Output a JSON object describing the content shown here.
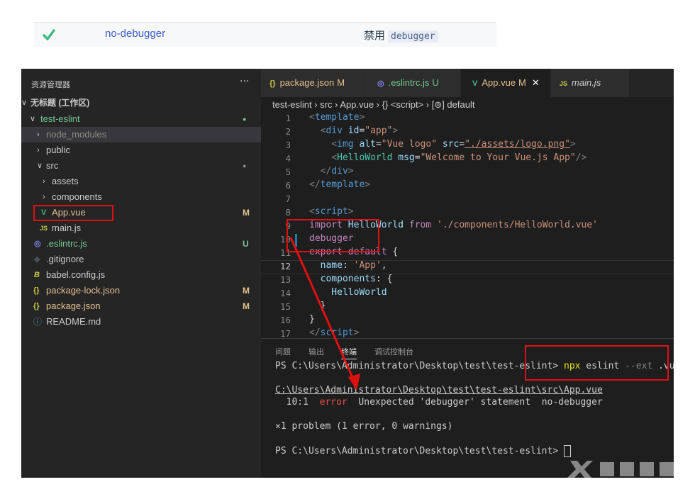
{
  "rule_row": {
    "rule_name": "no-debugger",
    "description_text": "禁用",
    "description_code": "debugger"
  },
  "explorer": {
    "title": "资源管理器",
    "more": "···",
    "workspace": "无标题 (工作区)",
    "items": [
      {
        "label": "test-eslint",
        "status": "●",
        "chev": "∨"
      },
      {
        "label": "node_modules",
        "chev": "›"
      },
      {
        "label": "public",
        "chev": "›"
      },
      {
        "label": "src",
        "status": "●",
        "chev": "∨"
      },
      {
        "label": "assets",
        "chev": "›"
      },
      {
        "label": "components",
        "chev": "›"
      },
      {
        "label": "App.vue",
        "status": "M",
        "icon": "V"
      },
      {
        "label": "main.js",
        "icon": "JS"
      },
      {
        "label": ".eslintrc.js",
        "status": "U",
        "icon": "◎"
      },
      {
        "label": ".gitignore",
        "icon": "◆"
      },
      {
        "label": "babel.config.js",
        "icon": "B"
      },
      {
        "label": "package-lock.json",
        "status": "M",
        "icon": "{}"
      },
      {
        "label": "package.json",
        "status": "M",
        "icon": "{}"
      },
      {
        "label": "README.md",
        "icon": "ⓘ"
      }
    ]
  },
  "tabs": [
    {
      "icon": "{}",
      "label": "package.json",
      "status": "M"
    },
    {
      "icon": "◎",
      "label": ".eslintrc.js",
      "status": "U"
    },
    {
      "icon": "V",
      "label": "App.vue",
      "status": "M",
      "close": "✕"
    },
    {
      "icon": "JS",
      "label": "main.js"
    }
  ],
  "breadcrumb": "test-eslint › src › App.vue › {} <script> › [⊚] default",
  "code": {
    "line_numbers": [
      "1",
      "2",
      "3",
      "4",
      "5",
      "6",
      "7",
      "8",
      "9",
      "10",
      "11",
      "12",
      "13",
      "14",
      "15",
      "16",
      "17"
    ],
    "l1_a": "<",
    "l1_b": "template",
    "l1_c": ">",
    "l2_a": "  <",
    "l2_b": "div",
    "l2_c": " id",
    "l2_d": "=",
    "l2_e": "\"app\"",
    "l2_f": ">",
    "l3_a": "    <",
    "l3_b": "img",
    "l3_c": " alt",
    "l3_d": "=",
    "l3_e": "\"Vue logo\"",
    "l3_f": " src",
    "l3_g": "=",
    "l3_h": "\"./assets/logo.png\"",
    "l3_i": ">",
    "l4_a": "    <",
    "l4_b": "HelloWorld",
    "l4_c": " msg",
    "l4_d": "=",
    "l4_e": "\"Welcome to Your Vue.js App\"",
    "l4_f": "/>",
    "l5_a": "  </",
    "l5_b": "div",
    "l5_c": ">",
    "l6_a": "</",
    "l6_b": "template",
    "l6_c": ">",
    "l8_a": "<",
    "l8_b": "script",
    "l8_c": ">",
    "l9_a": "import",
    "l9_b": " HelloWorld ",
    "l9_c": "from",
    "l9_d": " './components/HelloWorld.vue'",
    "l10": "debugger",
    "l11_a": "export default",
    "l11_b": " {",
    "l12_a": "  name",
    "l12_b": ": ",
    "l12_c": "'App'",
    "l12_d": ",",
    "l13_a": "  components",
    "l13_b": ": {",
    "l14": "    HelloWorld",
    "l15": "  }",
    "l16": "}",
    "l17_a": "</",
    "l17_b": "script",
    "l17_c": ">"
  },
  "panel": {
    "tabs": [
      "问题",
      "输出",
      "终端",
      "调试控制台"
    ],
    "cmd_prompt": "PS C:\\Users\\Administrator\\Desktop\\test\\test-eslint> ",
    "cmd_npx": "npx",
    "cmd_rest1": " eslint ",
    "cmd_ext": "--ext",
    "cmd_rest2": " .vue src/",
    "file_path": "C:\\Users\\Administrator\\Desktop\\test\\test-eslint\\src\\App.vue",
    "err_loc": "  10:1  ",
    "err_level": "error",
    "err_msg": "  Unexpected 'debugger' statement  no-debugger",
    "summary": "✕1 problem (1 error, 0 warnings)",
    "prompt2": "PS C:\\Users\\Administrator\\Desktop\\test\\test-eslint> "
  },
  "colors": {
    "accent_red": "#e01010",
    "vue_green": "#41b883",
    "json_yellow": "#cbcb41",
    "eslint_purple": "#8080f2"
  }
}
